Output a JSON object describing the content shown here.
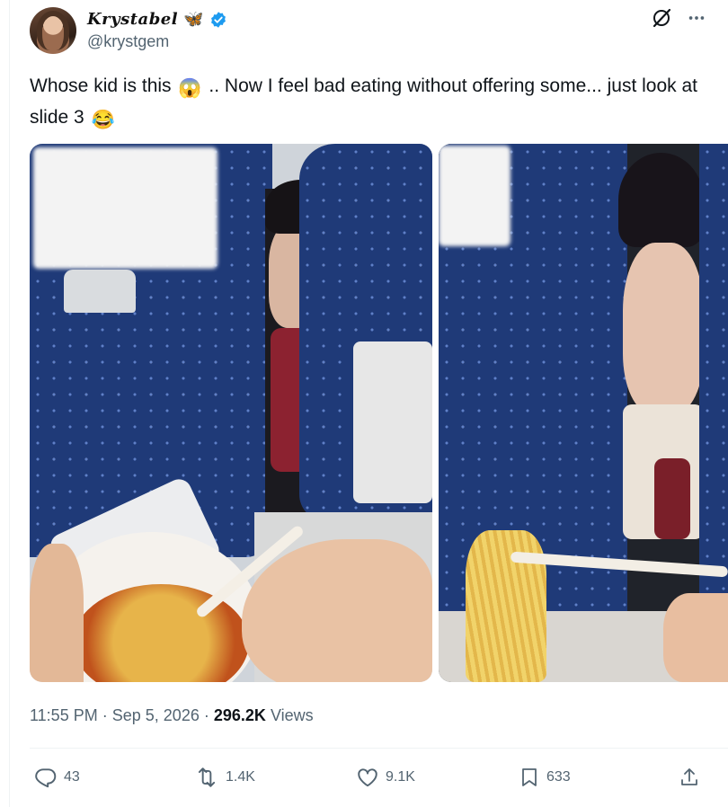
{
  "author": {
    "display_name": "Krystabel",
    "name_emoji": "🦋",
    "handle": "@krystgem",
    "verified": true
  },
  "icons": {
    "verified": "verified-badge-icon",
    "grok": "grok-icon",
    "more": "more-icon",
    "reply": "reply-icon",
    "retweet": "retweet-icon",
    "like": "like-icon",
    "bookmark": "bookmark-icon",
    "share": "share-icon"
  },
  "tweet": {
    "text_part1": "Whose kid is this",
    "emoji1": "😱",
    "text_part2": ".. Now I feel bad eating without offering some... just look at slide 3",
    "emoji2": "😂"
  },
  "meta": {
    "time": "11:55 PM",
    "separator": "·",
    "date": "Sep 5, 2026",
    "views_count": "296.2K",
    "views_label": "Views"
  },
  "actions": {
    "replies": "43",
    "retweets": "1.4K",
    "likes": "9.1K",
    "bookmarks": "633"
  },
  "colors": {
    "text": "#0f1419",
    "secondary": "#536471",
    "verified": "#1d9bf0",
    "divider": "#eff3f4"
  }
}
